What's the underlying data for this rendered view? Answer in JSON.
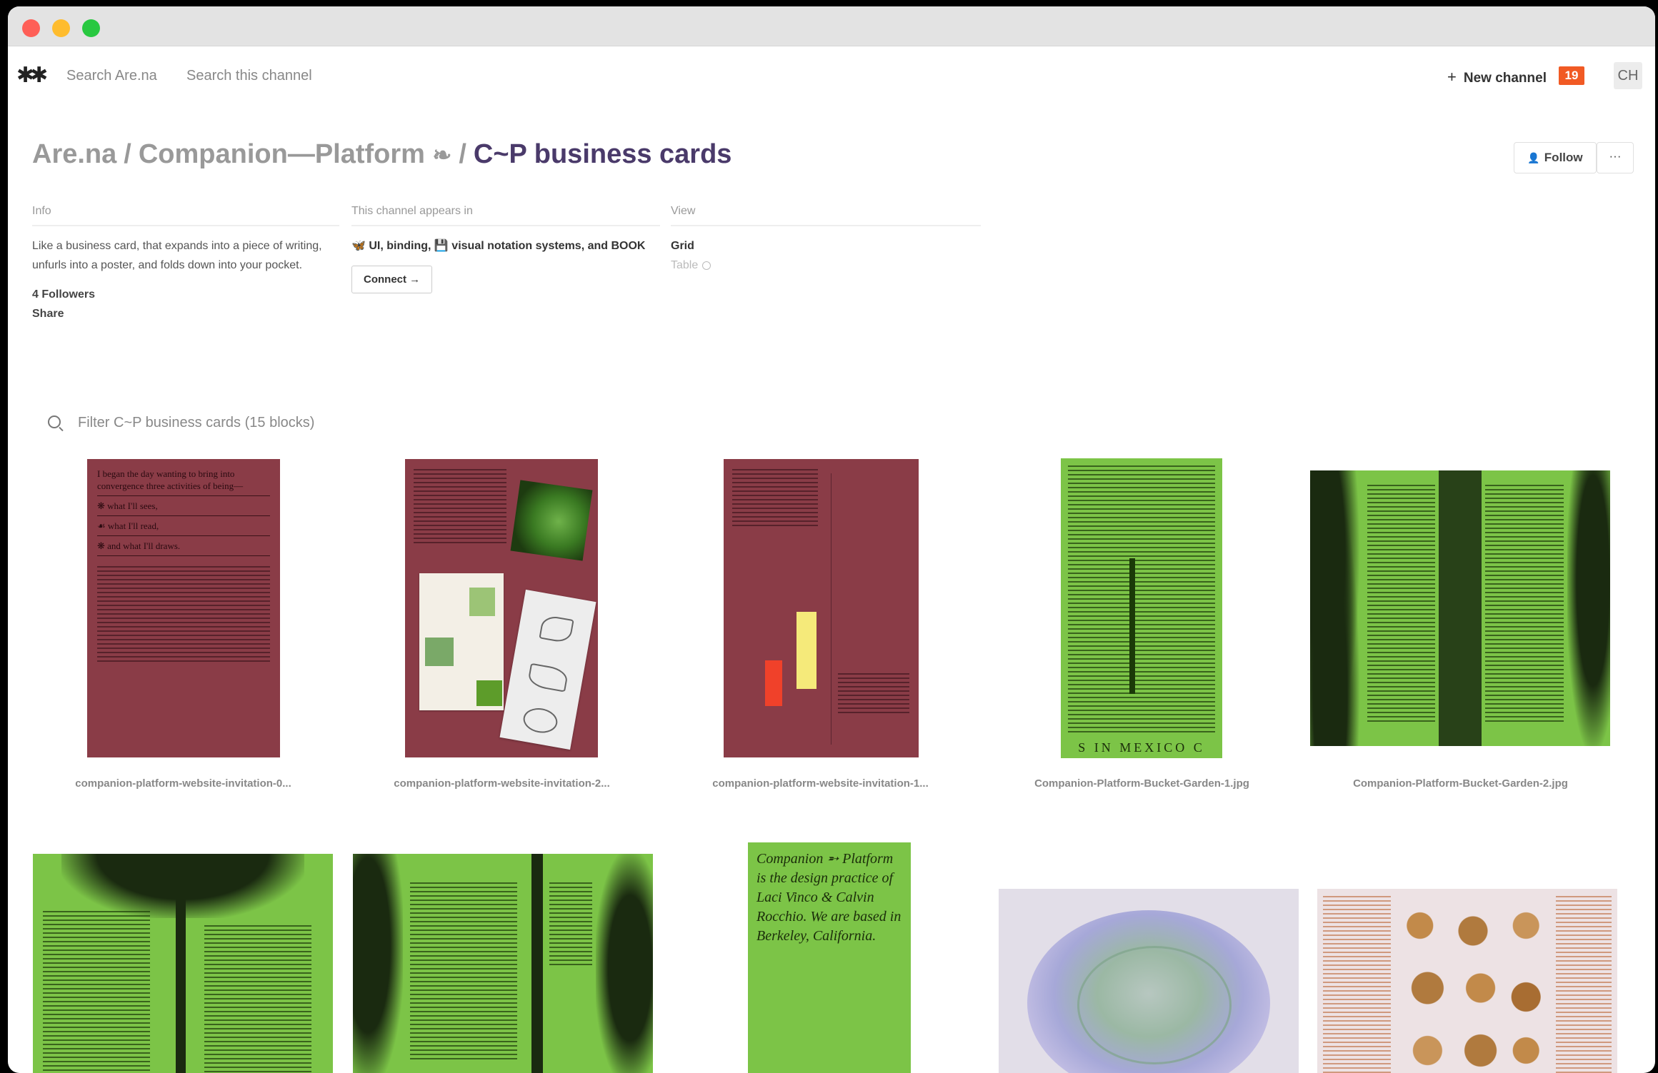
{
  "nav": {
    "logo": "✱✱",
    "search_arena": "Search Are.na",
    "search_channel": "Search this channel",
    "new_channel": "New channel",
    "notification_count": "19",
    "avatar_initials": "CH"
  },
  "breadcrumb": {
    "root": "Are.na",
    "parent": "Companion—Platform",
    "parent_icon": "❧",
    "current": "C~P business cards",
    "separator": "/"
  },
  "actions": {
    "follow": "Follow",
    "more": "···"
  },
  "info": {
    "heading": "Info",
    "description": "Like a business card, that expands into a piece of writing, unfurls into a poster, and folds down into your pocket.",
    "followers": "4 Followers",
    "share": "Share"
  },
  "appears_in": {
    "heading": "This channel appears in",
    "channels_text_1": "UI",
    "channels_text_2": ", binding,",
    "channels_text_3": "visual notation systems",
    "channels_text_4": ", and BOOK",
    "connect": "Connect →"
  },
  "view": {
    "heading": "View",
    "grid": "Grid",
    "table": "Table"
  },
  "filter": {
    "placeholder": "Filter C~P business cards (15 blocks)"
  },
  "blocks": [
    {
      "caption": "companion-platform-website-invitation-0..."
    },
    {
      "caption": "companion-platform-website-invitation-2..."
    },
    {
      "caption": "companion-platform-website-invitation-1..."
    },
    {
      "caption": "Companion-Platform-Bucket-Garden-1.jpg"
    },
    {
      "caption": "Companion-Platform-Bucket-Garden-2.jpg"
    }
  ],
  "card1_text": {
    "intro": "I began the day wanting to bring into convergence three activities of being—",
    "l1": "what I'll sees,",
    "l2": "what I'll read,",
    "l3": "and what I'll draws."
  },
  "card3_text": {
    "title": "Companion ➵ Platform is the design practice of Laci Vinco & Calvin Rocchio. We are based in Berkeley, California."
  },
  "card4_text": {
    "bottom": "S IN MEXICO C"
  }
}
